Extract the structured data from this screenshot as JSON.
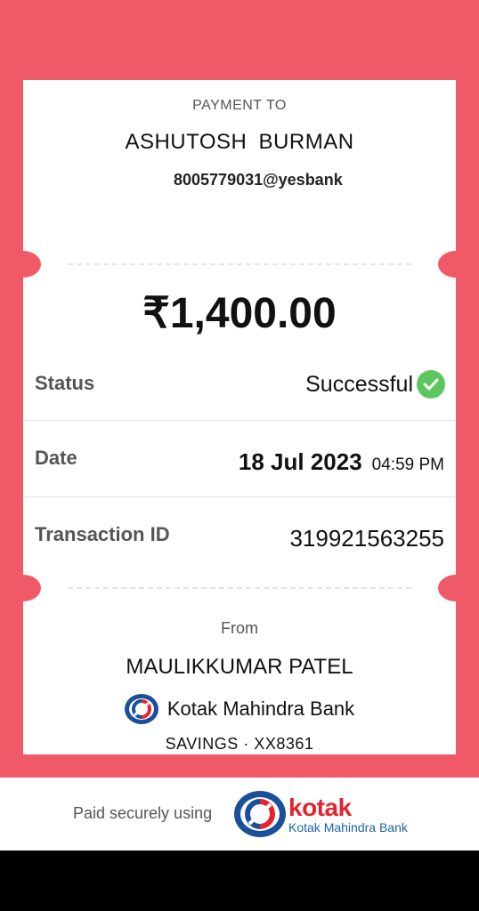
{
  "payment": {
    "label": "PAYMENT TO",
    "payee_name": "ASHUTOSH  BURMAN",
    "payee_vpa": "8005779031@yesbank"
  },
  "amount": "₹1,400.00",
  "details": {
    "status_label": "Status",
    "status_value": "Successful",
    "date_label": "Date",
    "date_value": "18 Jul 2023",
    "time_value": "04:59 PM",
    "txn_label": "Transaction ID",
    "txn_value": "319921563255"
  },
  "from": {
    "label": "From",
    "name": "MAULIKKUMAR PATEL",
    "bank_name": "Kotak Mahindra Bank",
    "account": "SAVINGS · XX8361"
  },
  "footer": {
    "text": "Paid securely using",
    "brand": "kotak",
    "brand_sub": "Kotak Mahindra Bank"
  },
  "colors": {
    "background": "#F05A68",
    "success": "#5cc761",
    "brand_red": "#E5232F",
    "brand_blue": "#1a63a8"
  },
  "icons": [
    "check-icon",
    "kotak-logo-icon"
  ]
}
